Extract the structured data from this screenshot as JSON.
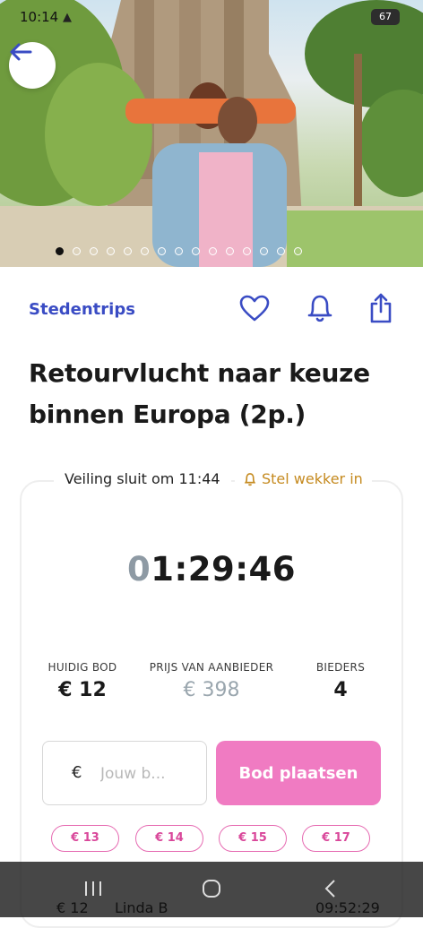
{
  "status_bar": {
    "time": "10:14",
    "battery": "67"
  },
  "hero": {
    "active_slide": 1,
    "slide_count": 15
  },
  "info": {
    "category": "Stedentrips",
    "title": "Retourvlucht naar keuze binnen Europa (2p.)"
  },
  "auction": {
    "closes_label": "Veiling sluit om 11:44",
    "alarm_label": "Stel wekker in",
    "timer_dim": "0",
    "timer_main": "1:29:46",
    "stats": {
      "current_bid_label": "HUIDIG BOD",
      "current_bid_value": "€ 12",
      "provider_price_label": "PRIJS VAN AANBIEDER",
      "provider_price_value": "€ 398",
      "bidders_label": "BIEDERS",
      "bidders_value": "4"
    },
    "bid_input": {
      "currency": "€",
      "placeholder": "Jouw b..."
    },
    "bid_button": "Bod plaatsen",
    "quick_bids": [
      "€ 13",
      "€ 14",
      "€ 15",
      "€ 17"
    ]
  },
  "ticker": {
    "amount": "€ 12",
    "bidder": "Linda B",
    "time": "09:52:29"
  },
  "colors": {
    "brand_blue": "#3a4cc4",
    "pink": "#f07bc2",
    "alarm": "#c58a1f"
  }
}
